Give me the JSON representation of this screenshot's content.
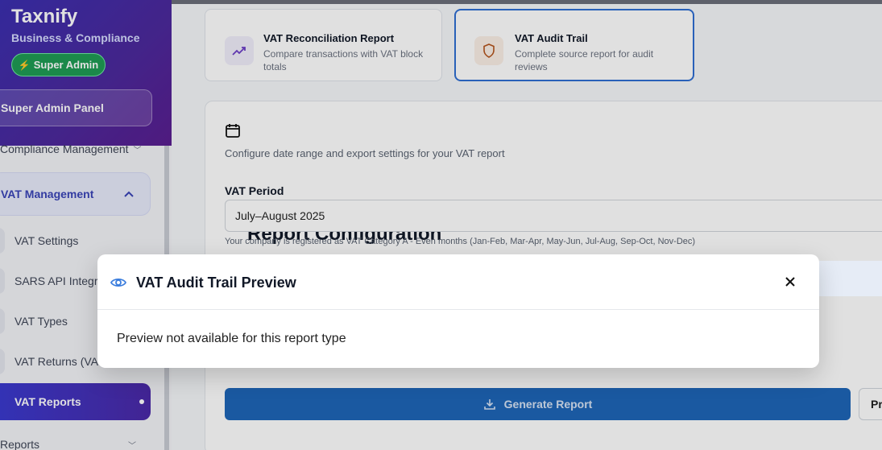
{
  "brand": {
    "title": "Taxnify",
    "subtitle": "Business & Compliance",
    "badge": "Super Admin"
  },
  "sidebar": {
    "admin_panel": "Super Admin Panel",
    "compliance": "Compliance Management",
    "vat_management": "VAT Management",
    "items": [
      "VAT Settings",
      "SARS API Integra",
      "VAT Types",
      "VAT Returns (VAT"
    ],
    "active": "VAT Reports",
    "reports": "Reports"
  },
  "cards": [
    {
      "title": "VAT Reconciliation Report",
      "desc": "Compare transactions with VAT block totals"
    },
    {
      "title": "VAT Audit Trail",
      "desc": "Complete source report for audit reviews"
    }
  ],
  "config": {
    "title": "Report Configuration",
    "subtitle": "Configure date range and export settings for your VAT report",
    "period_label": "VAT Period",
    "period_value": "July–August 2025",
    "help": "Your company is registered as VAT Category A - Even months (Jan-Feb, Mar-Apr, May-Jun, Jul-Aug, Sep-Oct, Nov-Dec)",
    "generate": "Generate Report",
    "preview": "Pr"
  },
  "modal": {
    "title": "VAT Audit Trail Preview",
    "body": "Preview not available for this report type"
  },
  "colors": {
    "accent": "#1e66b8",
    "brand": "#4b2a9e",
    "badge": "#1f9d55"
  }
}
